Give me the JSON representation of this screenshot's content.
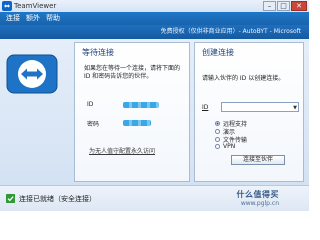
{
  "window": {
    "title": "TeamViewer",
    "controls": {
      "minimize": "–",
      "maximize": "□",
      "close": "✕"
    }
  },
  "menu": {
    "items": [
      "连接",
      "额外",
      "帮助"
    ]
  },
  "banner": {
    "license_text": "免费授权（仅供非商业应用）- AutoBYT - Microsoft"
  },
  "left_panel": {
    "title": "等待连接",
    "description": "如果您在等待一个连接，请将下面的 ID 和密码告诉您的伙伴。",
    "id_label": "ID",
    "password_label": "密码",
    "unattended_link": "为无人值守配置永久访问"
  },
  "right_panel": {
    "title": "创建连接",
    "instruction": "请输入伙伴的 ID 以创建连接。",
    "id_label": "ID",
    "id_value": "",
    "options": [
      {
        "label": "远程支持",
        "selected": true
      },
      {
        "label": "演示",
        "selected": false
      },
      {
        "label": "文件传输",
        "selected": false
      },
      {
        "label": "VPN",
        "selected": false
      }
    ],
    "connect_button": "连接至伙伴"
  },
  "status": {
    "text": "连接已就绪（安全连接）",
    "brand": "什么值得买",
    "brand_sub": "www.pglp.cn"
  },
  "colors": {
    "menu_bar": "#1f77c8",
    "panel_title": "#1c3f7a",
    "status_ok": "#2f9a35",
    "masked_value": "#3aa7e6"
  },
  "icons": {
    "app": "teamviewer-icon",
    "logo": "teamviewer-arrows-icon",
    "status": "check-icon",
    "dropdown": "chevron-down-icon"
  }
}
